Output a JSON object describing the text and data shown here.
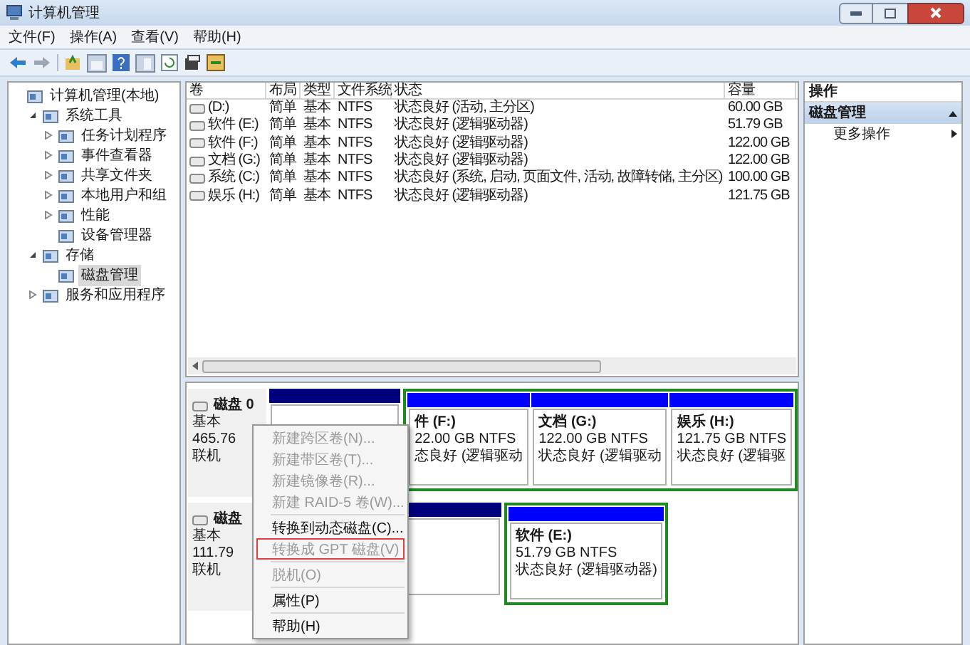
{
  "window": {
    "title": "计算机管理"
  },
  "menu_bar": [
    "文件(F)",
    "操作(A)",
    "查看(V)",
    "帮助(H)"
  ],
  "tree": [
    {
      "label": "计算机管理(本地)",
      "selected": false,
      "children": [
        {
          "label": "系统工具",
          "expanded": true,
          "selected": false,
          "children": [
            {
              "label": "任务计划程序",
              "expanded": false,
              "selected": false
            },
            {
              "label": "事件查看器",
              "expanded": false,
              "selected": false
            },
            {
              "label": "共享文件夹",
              "expanded": false,
              "selected": false
            },
            {
              "label": "本地用户和组",
              "expanded": false,
              "selected": false
            },
            {
              "label": "性能",
              "expanded": false,
              "selected": false
            },
            {
              "label": "设备管理器",
              "selected": false
            }
          ]
        },
        {
          "label": "存储",
          "expanded": true,
          "selected": false,
          "children": [
            {
              "label": "磁盘管理",
              "selected": true
            }
          ]
        },
        {
          "label": "服务和应用程序",
          "expanded": false,
          "selected": false
        }
      ]
    }
  ],
  "volume_table": {
    "columns": [
      "卷",
      "布局",
      "类型",
      "文件系统",
      "状态",
      "容量"
    ],
    "rows": [
      [
        "(D:)",
        "简单",
        "基本",
        "NTFS",
        "状态良好 (活动, 主分区)",
        "60.00 GB"
      ],
      [
        "软件 (E:)",
        "简单",
        "基本",
        "NTFS",
        "状态良好 (逻辑驱动器)",
        "51.79 GB"
      ],
      [
        "软件 (F:)",
        "简单",
        "基本",
        "NTFS",
        "状态良好 (逻辑驱动器)",
        "122.00 GB"
      ],
      [
        "文档 (G:)",
        "简单",
        "基本",
        "NTFS",
        "状态良好 (逻辑驱动器)",
        "122.00 GB"
      ],
      [
        "系统 (C:)",
        "简单",
        "基本",
        "NTFS",
        "状态良好 (系统, 启动, 页面文件, 活动, 故障转储, 主分区)",
        "100.00 GB"
      ],
      [
        "娱乐 (H:)",
        "简单",
        "基本",
        "NTFS",
        "状态良好 (逻辑驱动器)",
        "121.75 GB"
      ]
    ]
  },
  "disks": [
    {
      "name": "磁盘 0",
      "type": "基本",
      "size": "465.76",
      "status": "联机",
      "partitions": [
        {
          "kind": "primary"
        },
        {
          "kind": "logical",
          "lines": [
            "件 (F:)",
            "22.00 GB NTFS",
            "态良好 (逻辑驱动"
          ]
        },
        {
          "kind": "logical",
          "lines": [
            "文档 (G:)",
            "122.00 GB NTFS",
            "状态良好 (逻辑驱动"
          ]
        },
        {
          "kind": "logical",
          "lines": [
            "娱乐 (H:)",
            "121.75 GB NTFS",
            "状态良好 (逻辑驱"
          ]
        }
      ]
    },
    {
      "name": "磁盘",
      "type": "基本",
      "size": "111.79",
      "status": "联机",
      "partitions": [
        {
          "kind": "primary"
        },
        {
          "kind": "logical",
          "lines": [
            "软件 (E:)",
            "51.79 GB NTFS",
            "状态良好 (逻辑驱动器)"
          ]
        }
      ]
    }
  ],
  "context_menu": [
    {
      "label": "新建跨区卷(N)...",
      "disabled": true,
      "highlighted": false,
      "separator_after": false
    },
    {
      "label": "新建带区卷(T)...",
      "disabled": true,
      "highlighted": false,
      "separator_after": false
    },
    {
      "label": "新建镜像卷(R)...",
      "disabled": true,
      "highlighted": false,
      "separator_after": false
    },
    {
      "label": "新建 RAID-5 卷(W)...",
      "disabled": true,
      "highlighted": false,
      "separator_after": true
    },
    {
      "label": "转换到动态磁盘(C)...",
      "disabled": false,
      "highlighted": false,
      "separator_after": false
    },
    {
      "label": "转换成 GPT 磁盘(V)",
      "disabled": true,
      "highlighted": true,
      "separator_after": true
    },
    {
      "label": "脱机(O)",
      "disabled": true,
      "highlighted": false,
      "separator_after": true
    },
    {
      "label": "属性(P)",
      "disabled": false,
      "highlighted": false,
      "separator_after": true
    },
    {
      "label": "帮助(H)",
      "disabled": false,
      "highlighted": false,
      "separator_after": false
    }
  ],
  "actions_panel": {
    "title": "操作",
    "section": {
      "label": "磁盘管理",
      "expanded": true
    },
    "items": [
      "更多操作"
    ]
  }
}
